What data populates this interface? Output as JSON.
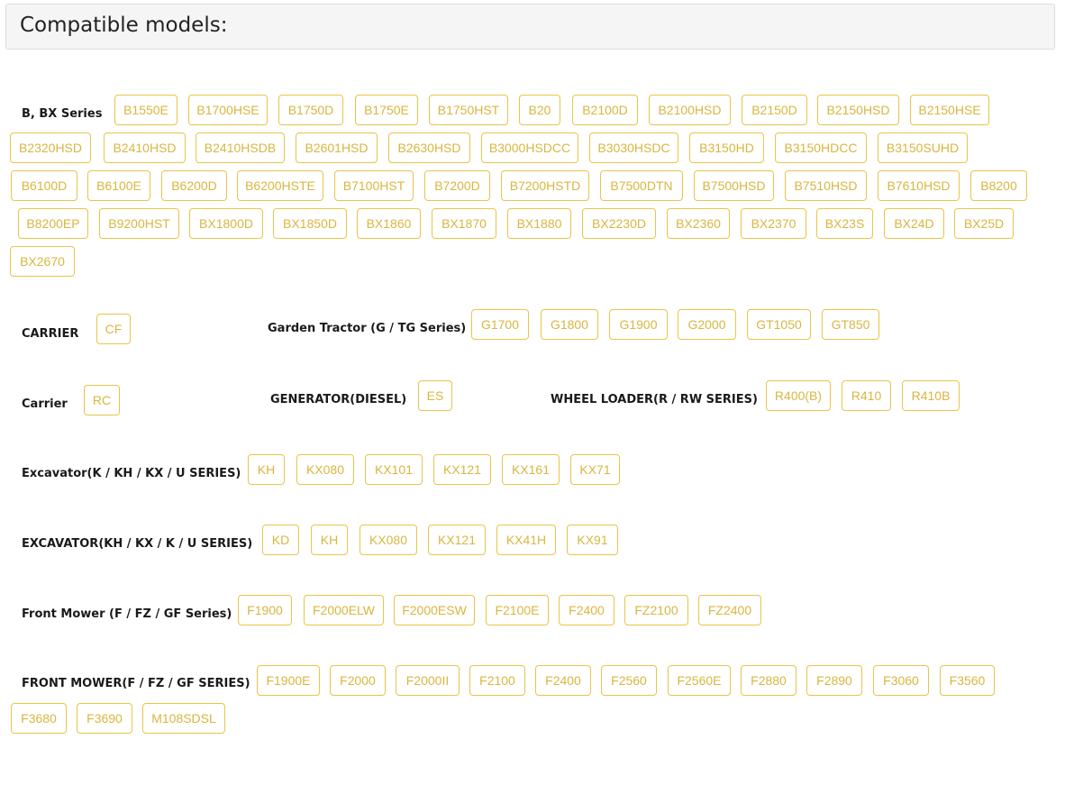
{
  "page_title": "Compatible models:",
  "series": [
    {
      "label": "B, BX Series",
      "models": [
        "B1550E",
        "B1700HSE",
        "B1750D",
        "B1750E",
        "B1750HST",
        "B20",
        "B2100D",
        "B2100HSD",
        "B2150D",
        "B2150HSD",
        "B2150HSE",
        "B2320HSD",
        "B2410HSD",
        "B2410HSDB",
        "B2601HSD",
        "B2630HSD",
        "B3000HSDCC",
        "B3030HSDC",
        "B3150HD",
        "B3150HDCC",
        "B3150SUHD",
        "B6100D",
        "B6100E",
        "B6200D",
        "B6200HSTE",
        "B7100HST",
        "B7200D",
        "B7200HSTD",
        "B7500DTN",
        "B7500HSD",
        "B7510HSD",
        "B7610HSD",
        "B8200",
        "B8200EP",
        "B9200HST",
        "BX1800D",
        "BX1850D",
        "BX1860",
        "BX1870",
        "BX1880",
        "BX2230D",
        "BX2360",
        "BX2370",
        "BX23S",
        "BX24D",
        "BX25D",
        "BX2670"
      ]
    },
    {
      "label": "CARRIER",
      "models": [
        "CF"
      ]
    },
    {
      "label": "Garden Tractor (G / TG Series)",
      "models": [
        "G1700",
        "G1800",
        "G1900",
        "G2000",
        "GT1050",
        "GT850"
      ]
    },
    {
      "label": "Carrier",
      "models": [
        "RC"
      ]
    },
    {
      "label": "GENERATOR(DIESEL)",
      "models": [
        "ES"
      ]
    },
    {
      "label": "WHEEL LOADER(R / RW SERIES)",
      "models": [
        "R400(B)",
        "R410",
        "R410B"
      ]
    },
    {
      "label": "Excavator(K / KH / KX / U SERIES)",
      "models": [
        "KH",
        "KX080",
        "KX101",
        "KX121",
        "KX161",
        "KX71"
      ]
    },
    {
      "label": "EXCAVATOR(KH / KX / K / U SERIES)",
      "models": [
        "KD",
        "KH",
        "KX080",
        "KX121",
        "KX41H",
        "KX91"
      ]
    },
    {
      "label": "Front Mower (F / FZ / GF Series)",
      "models": [
        "F1900",
        "F2000ELW",
        "F2000ESW",
        "F2100E",
        "F2400",
        "FZ2100",
        "FZ2400"
      ]
    },
    {
      "label": "FRONT MOWER(F / FZ / GF SERIES)",
      "models": [
        "F1900E",
        "F2000",
        "F2000II",
        "F2100",
        "F2400",
        "F2560",
        "F2560E",
        "F2880",
        "F2890",
        "F3060",
        "F3560",
        "F3680",
        "F3690",
        "M108SDSL"
      ]
    }
  ],
  "colors": {
    "tag_border": "#e8c547",
    "tag_text": "#d9b640",
    "header_bg": "#f5f5f5",
    "header_border": "#dcdcdc"
  }
}
